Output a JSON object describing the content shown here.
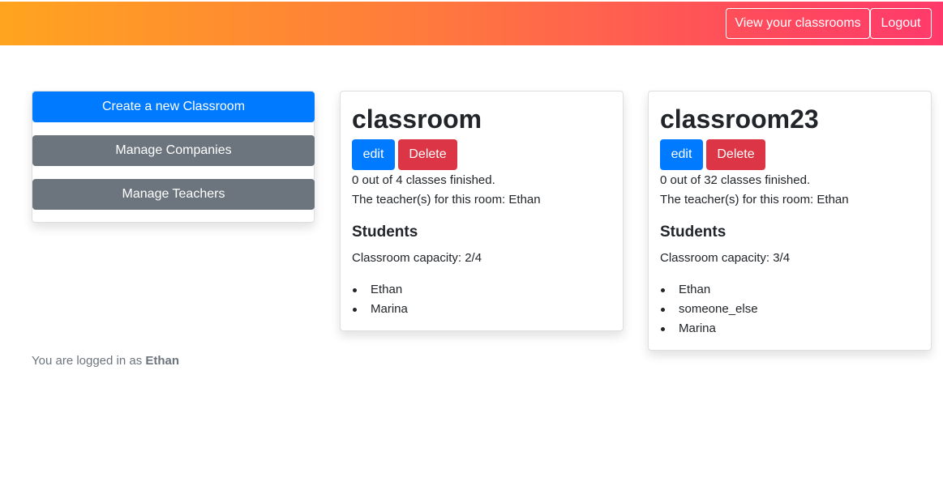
{
  "navbar": {
    "view_classrooms_label": "View your classrooms",
    "logout_label": "Logout"
  },
  "sidebar": {
    "create_label": "Create a new Classroom",
    "companies_label": "Manage Companies",
    "teachers_label": "Manage Teachers"
  },
  "classrooms": [
    {
      "title": "classroom",
      "edit_label": "edit",
      "delete_label": "Delete",
      "classes_text": "0 out of 4 classes finished.",
      "teachers_text": "The teacher(s) for this room: Ethan",
      "students_heading": "Students",
      "capacity_text": "Classroom capacity: 2/4",
      "students": [
        "Ethan",
        "Marina"
      ]
    },
    {
      "title": "classroom23",
      "edit_label": "edit",
      "delete_label": "Delete",
      "classes_text": "0 out of 32 classes finished.",
      "teachers_text": "The teacher(s) for this room: Ethan",
      "students_heading": "Students",
      "capacity_text": "Classroom capacity: 3/4",
      "students": [
        "Ethan",
        "someone_else",
        "Marina"
      ]
    }
  ],
  "footer": {
    "logged_in_prefix": "You are logged in as ",
    "username": "Ethan"
  },
  "colors": {
    "primary": "#007bff",
    "secondary": "#6c757d",
    "danger": "#dc3545",
    "gradient_start": "#ffa41f",
    "gradient_end": "#ff3a6b"
  }
}
